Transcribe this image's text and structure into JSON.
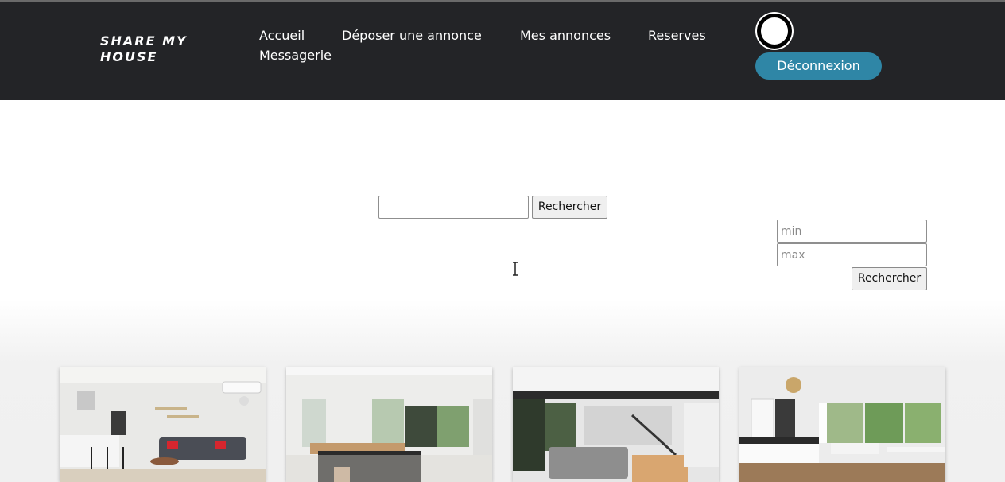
{
  "header": {
    "brand": "SHARE MY HOUSE",
    "nav": [
      "Accueil",
      "Déposer une annonce",
      "Mes annonces",
      "Reserves",
      "Messagerie"
    ],
    "logout_label": "Déconnexion"
  },
  "search": {
    "value": "",
    "button_label": "Rechercher"
  },
  "price_filter": {
    "min_placeholder": "min",
    "max_placeholder": "max",
    "button_label": "Rechercher"
  },
  "listings": [
    {
      "image": "living-room-gray-sofa"
    },
    {
      "image": "open-plan-dining-kitchen"
    },
    {
      "image": "loft-living-room-staircase"
    },
    {
      "image": "modern-kitchen-garden-view"
    }
  ],
  "colors": {
    "header_bg": "#232427",
    "accent": "#2f86a6"
  }
}
